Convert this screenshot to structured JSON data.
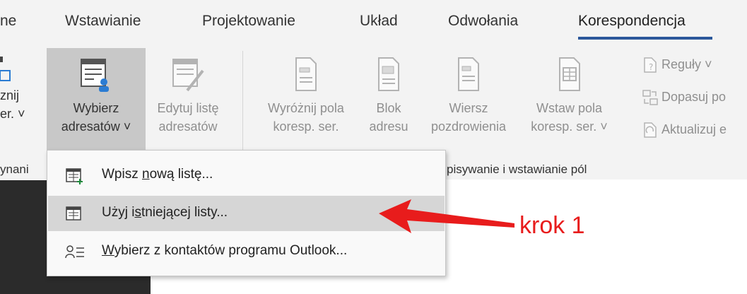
{
  "tabs": [
    {
      "label": "ne"
    },
    {
      "label": "Wstawianie"
    },
    {
      "label": "Projektowanie"
    },
    {
      "label": "Układ"
    },
    {
      "label": "Odwołania"
    },
    {
      "label": "Korespondencja",
      "active": true
    }
  ],
  "ribbon": {
    "partial_left": {
      "line1": "znij",
      "line2": "er. ˅"
    },
    "select_recipients": {
      "line1": "Wybierz",
      "line2": "adresatów ˅"
    },
    "edit_list": {
      "line1": "Edytuj listę",
      "line2": "adresatów"
    },
    "highlight_fields": {
      "line1": "Wyróżnij pola",
      "line2": "koresp. ser."
    },
    "address_block": {
      "line1": "Blok",
      "line2": "adresu"
    },
    "greeting_line": {
      "line1": "Wiersz",
      "line2": "pozdrowienia"
    },
    "insert_field": {
      "line1": "Wstaw pola",
      "line2": "koresp. ser. ˅"
    },
    "rules": "Reguły ˅",
    "match_fields": "Dopasuj po",
    "update_labels": "Aktualizuj e"
  },
  "group_labels": {
    "left": "ynani",
    "right": "pisywanie i wstawianie pól"
  },
  "menu": {
    "items": [
      {
        "pre": "Wpisz ",
        "ul": "n",
        "post": "ową listę..."
      },
      {
        "pre": "Użyj i",
        "ul": "s",
        "post": "tniejącej listy..."
      },
      {
        "pre": "",
        "ul": "W",
        "post": "ybierz z kontaktów programu Outlook..."
      }
    ]
  },
  "annotation": {
    "text": "krok 1",
    "color": "#e81c1c"
  },
  "colors": {
    "accent": "#2b579a",
    "ribbon_bg": "#f3f3f3",
    "pressed": "#c8c8c8",
    "hover": "#d6d6d6"
  }
}
